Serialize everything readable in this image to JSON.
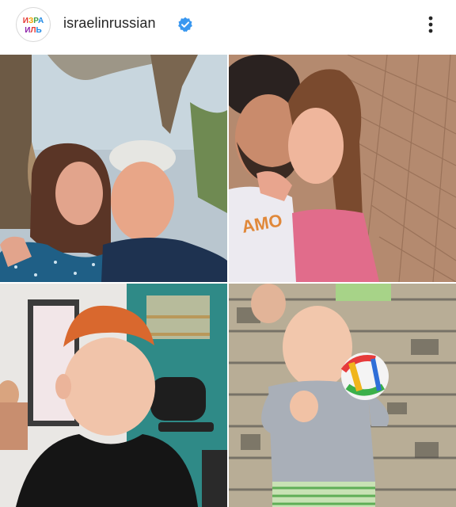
{
  "post_header": {
    "avatar_text_top": "ИЗРА",
    "avatar_text_bottom": "ИЛЬ",
    "username": "israelinrussian",
    "verified_icon": "verified-badge-icon",
    "more_icon": "more-vertical-icon",
    "accent_color": "#3897f0"
  },
  "photos": [
    {
      "subject": "photo-older-couple"
    },
    {
      "subject": "photo-young-couple"
    },
    {
      "subject": "photo-red-haired-boy"
    },
    {
      "subject": "photo-baby-with-ball"
    }
  ]
}
